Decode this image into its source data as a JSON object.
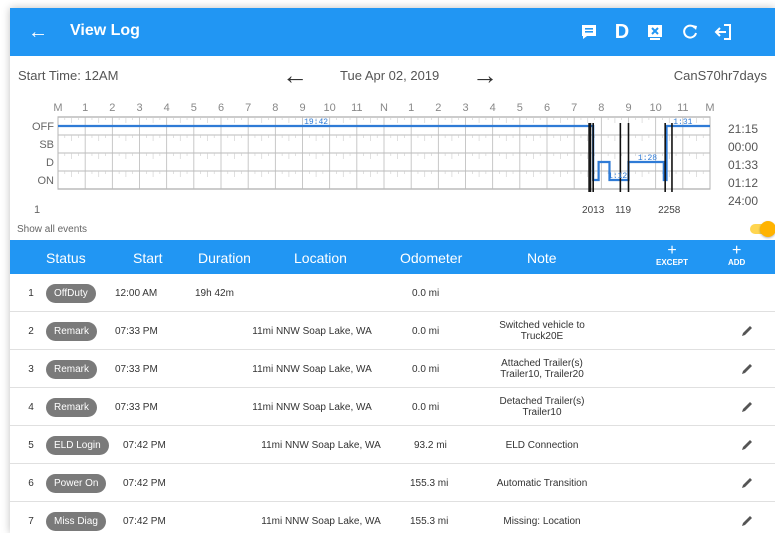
{
  "header": {
    "back_icon": "back-arrow-icon",
    "title": "View Log",
    "actions": [
      {
        "icon": "comment-icon"
      },
      {
        "label": "D"
      },
      {
        "icon": "close-box-icon"
      },
      {
        "icon": "refresh-icon"
      },
      {
        "icon": "logout-icon"
      }
    ]
  },
  "datebar": {
    "start_time": "Start Time: 12AM",
    "date": "Tue Apr 02, 2019",
    "cycle": "CanS70hr7days"
  },
  "grid": {
    "hour_labels": [
      "M",
      "1",
      "2",
      "3",
      "4",
      "5",
      "6",
      "7",
      "8",
      "9",
      "10",
      "11",
      "N",
      "1",
      "2",
      "3",
      "4",
      "5",
      "6",
      "7",
      "8",
      "9",
      "10",
      "11",
      "M"
    ],
    "status_labels": [
      "OFF",
      "SB",
      "D",
      "ON"
    ],
    "totals": [
      "21:15",
      "00:00",
      "01:33",
      "01:12",
      "24:00"
    ],
    "page_number": "1",
    "duration_labels": [
      "19:42",
      "1:12",
      "1:28",
      "1:31"
    ],
    "event_labels": [
      "2013",
      "119",
      "2258"
    ]
  },
  "controls": {
    "show_all_events": "Show all events",
    "toggle_on": true
  },
  "table": {
    "headers": {
      "status": "Status",
      "start": "Start",
      "duration": "Duration",
      "location": "Location",
      "odometer": "Odometer",
      "note": "Note"
    },
    "except_label": "EXCEPT",
    "add_label": "ADD",
    "rows": [
      {
        "num": "1",
        "status": "OffDuty",
        "start": "12:00 AM",
        "duration": "19h 42m",
        "location": "",
        "odometer": "0.0 mi",
        "note": "",
        "editable": false
      },
      {
        "num": "2",
        "status": "Remark",
        "start": "07:33 PM",
        "duration": "",
        "location": "11mi NNW Soap Lake, WA",
        "odometer": "0.0 mi",
        "note": "Switched vehicle to Truck20E",
        "editable": true
      },
      {
        "num": "3",
        "status": "Remark",
        "start": "07:33 PM",
        "duration": "",
        "location": "11mi NNW Soap Lake, WA",
        "odometer": "0.0 mi",
        "note": "Attached Trailer(s) Trailer10, Trailer20",
        "editable": true
      },
      {
        "num": "4",
        "status": "Remark",
        "start": "07:33 PM",
        "duration": "",
        "location": "11mi NNW Soap Lake, WA",
        "odometer": "0.0 mi",
        "note": "Detached Trailer(s) Trailer10",
        "editable": true
      },
      {
        "num": "5",
        "status": "ELD Login",
        "start": "07:42 PM",
        "duration": "",
        "location": "11mi NNW Soap Lake, WA",
        "odometer": "93.2 mi",
        "note": "ELD Connection",
        "editable": true
      },
      {
        "num": "6",
        "status": "Power On",
        "start": "07:42 PM",
        "duration": "",
        "location": "",
        "odometer": "155.3 mi",
        "note": "Automatic Transition",
        "editable": true
      },
      {
        "num": "7",
        "status": "Miss Diag",
        "start": "07:42 PM",
        "duration": "",
        "location": "11mi NNW Soap Lake, WA",
        "odometer": "155.3 mi",
        "note": "Missing: Location",
        "editable": true
      }
    ]
  },
  "colors": {
    "primary": "#2196f3",
    "pill": "#7a7a7a",
    "toggle": "#ffb300"
  }
}
